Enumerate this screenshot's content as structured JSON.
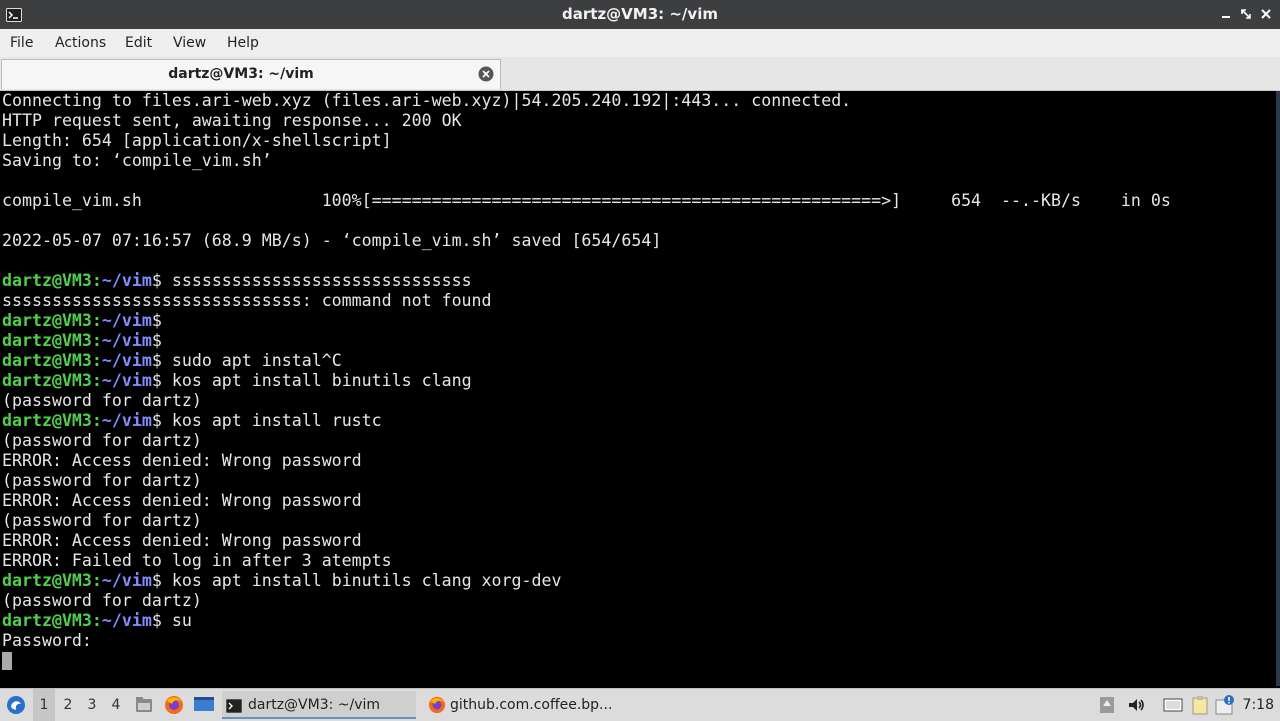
{
  "window": {
    "title": "dartz@VM3: ~/vim"
  },
  "menu": [
    "File",
    "Actions",
    "Edit",
    "View",
    "Help"
  ],
  "tab": {
    "label": "dartz@VM3: ~/vim"
  },
  "terminal": {
    "lines": [
      {
        "text": "Connecting to files.ari-web.xyz (files.ari-web.xyz)|54.205.240.192|:443... connected."
      },
      {
        "text": "HTTP request sent, awaiting response... 200 OK"
      },
      {
        "text": "Length: 654 [application/x-shellscript]"
      },
      {
        "text": "Saving to: ‘compile_vim.sh’"
      },
      {
        "text": ""
      },
      {
        "text": "compile_vim.sh                  100%[===================================================>]     654  --.-KB/s    in 0s"
      },
      {
        "text": ""
      },
      {
        "text": "2022-05-07 07:16:57 (68.9 MB/s) - ‘compile_vim.sh’ saved [654/654]"
      },
      {
        "text": ""
      },
      {
        "prompt": true,
        "user": "dartz@VM3",
        "path": "~/vim",
        "cmd": "ssssssssssssssssssssssssssssss"
      },
      {
        "text": "ssssssssssssssssssssssssssssss: command not found"
      },
      {
        "prompt": true,
        "user": "dartz@VM3",
        "path": "~/vim",
        "cmd": ""
      },
      {
        "prompt": true,
        "user": "dartz@VM3",
        "path": "~/vim",
        "cmd": ""
      },
      {
        "prompt": true,
        "user": "dartz@VM3",
        "path": "~/vim",
        "cmd": "sudo apt instal^C"
      },
      {
        "prompt": true,
        "user": "dartz@VM3",
        "path": "~/vim",
        "cmd": "kos apt install binutils clang"
      },
      {
        "text": "(password for dartz)"
      },
      {
        "prompt": true,
        "user": "dartz@VM3",
        "path": "~/vim",
        "cmd": "kos apt install rustc"
      },
      {
        "text": "(password for dartz)"
      },
      {
        "text": "ERROR: Access denied: Wrong password"
      },
      {
        "text": "(password for dartz)"
      },
      {
        "text": "ERROR: Access denied: Wrong password"
      },
      {
        "text": "(password for dartz)"
      },
      {
        "text": "ERROR: Access denied: Wrong password"
      },
      {
        "text": "ERROR: Failed to log in after 3 atempts"
      },
      {
        "prompt": true,
        "user": "dartz@VM3",
        "path": "~/vim",
        "cmd": "kos apt install binutils clang xorg-dev"
      },
      {
        "text": "(password for dartz)"
      },
      {
        "prompt": true,
        "user": "dartz@VM3",
        "path": "~/vim",
        "cmd": "su"
      },
      {
        "text": "Password:"
      },
      {
        "cursor": true
      }
    ]
  },
  "taskbar": {
    "workspaces": [
      "1",
      "2",
      "3",
      "4"
    ],
    "active_workspace": "1",
    "tasks": [
      {
        "label": "dartz@VM3: ~/vim",
        "icon": "terminal-icon",
        "active": true
      },
      {
        "label": "github.com.coffee.bp...",
        "icon": "firefox-icon",
        "active": false
      }
    ],
    "clock": "7:18"
  },
  "colors": {
    "prompt_user": "#4fd04a",
    "prompt_path": "#7f8cff",
    "titlebar": "#3c3e40"
  }
}
